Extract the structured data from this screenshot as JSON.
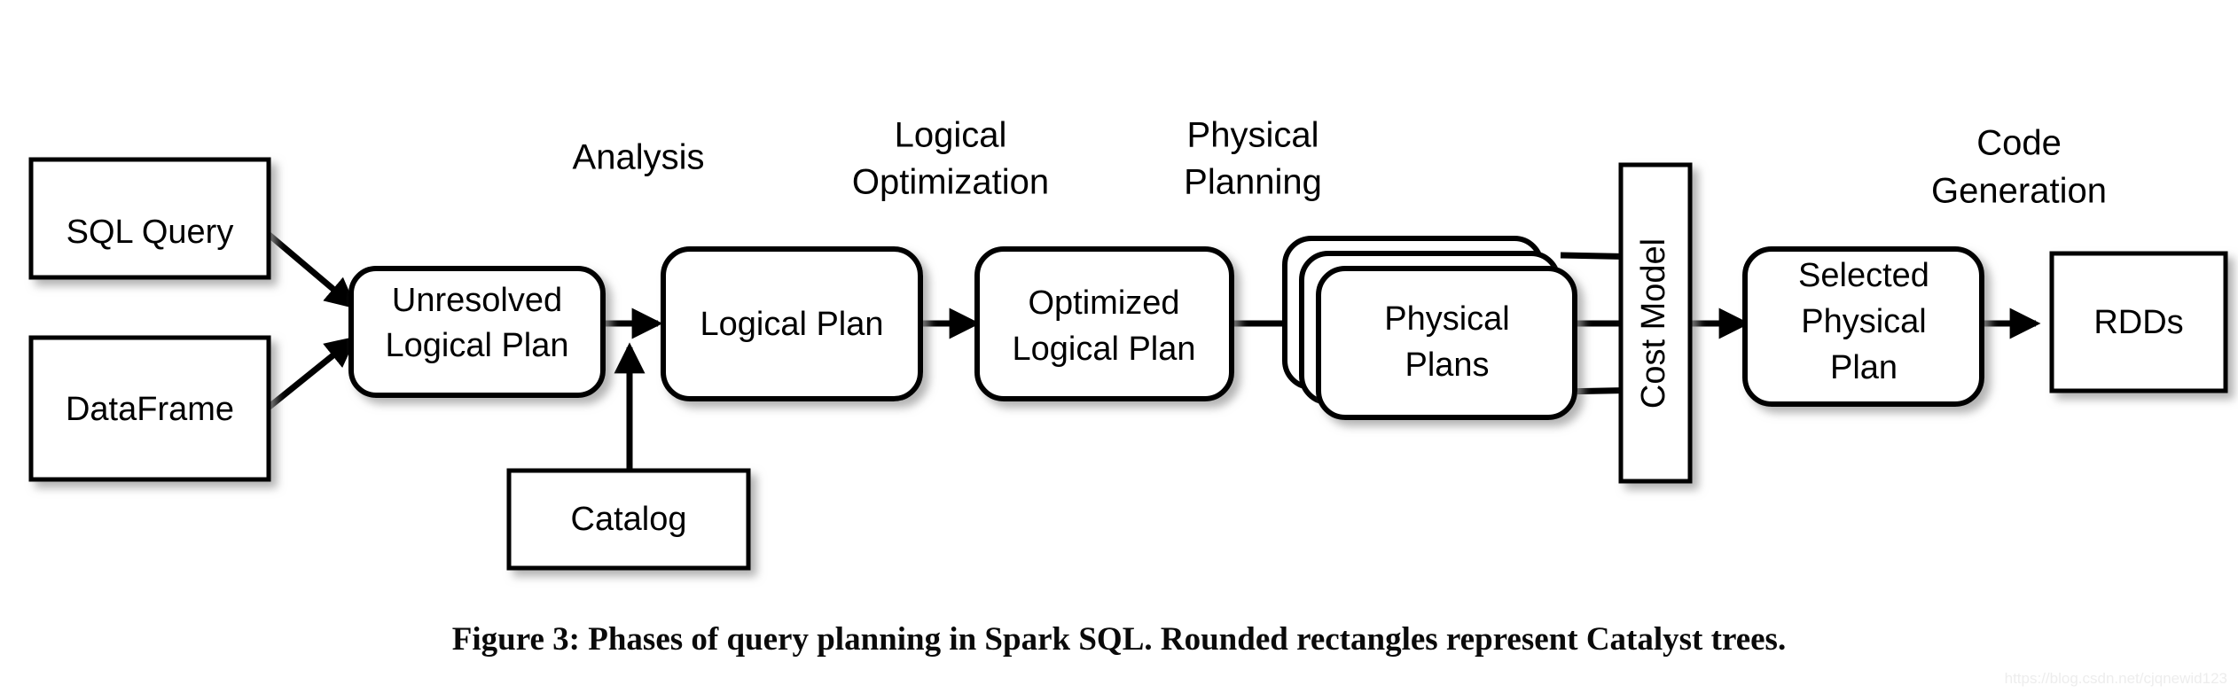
{
  "figure": {
    "caption": "Figure 3: Phases of query planning in Spark SQL. Rounded rectangles represent Catalyst trees.",
    "watermark": "https://blog.csdn.net/cjqnewid123"
  },
  "colors": {
    "stroke": "#000000",
    "fill": "#ffffff",
    "shadow": "#b4b4b4",
    "watermark": "#ededed"
  },
  "phases": [
    {
      "id": "analysis",
      "lines": [
        "Analysis"
      ]
    },
    {
      "id": "logical-optimization",
      "lines": [
        "Logical",
        "Optimization"
      ]
    },
    {
      "id": "physical-planning",
      "lines": [
        "Physical",
        "Planning"
      ]
    },
    {
      "id": "code-generation",
      "lines": [
        "Code",
        "Generation"
      ]
    }
  ],
  "nodes": [
    {
      "id": "sql-query",
      "shape": "rectangle",
      "lines": [
        "SQL Query"
      ]
    },
    {
      "id": "dataframe",
      "shape": "rectangle",
      "lines": [
        "DataFrame"
      ]
    },
    {
      "id": "unresolved-logical-plan",
      "shape": "rounded-rectangle",
      "lines": [
        "Unresolved",
        "Logical Plan"
      ]
    },
    {
      "id": "catalog",
      "shape": "rectangle",
      "lines": [
        "Catalog"
      ]
    },
    {
      "id": "logical-plan",
      "shape": "rounded-rectangle",
      "lines": [
        "Logical Plan"
      ]
    },
    {
      "id": "optimized-logical-plan",
      "shape": "rounded-rectangle",
      "lines": [
        "Optimized",
        "Logical Plan"
      ]
    },
    {
      "id": "physical-plans",
      "shape": "rounded-rectangle-stack",
      "lines": [
        "Physical",
        "Plans"
      ]
    },
    {
      "id": "cost-model",
      "shape": "rectangle-vertical",
      "lines": [
        "Cost Model"
      ]
    },
    {
      "id": "selected-physical-plan",
      "shape": "rounded-rectangle",
      "lines": [
        "Selected",
        "Physical",
        "Plan"
      ]
    },
    {
      "id": "rdds",
      "shape": "rectangle",
      "lines": [
        "RDDs"
      ]
    }
  ],
  "edges": [
    {
      "from": "sql-query",
      "to": "unresolved-logical-plan",
      "kind": "arrow"
    },
    {
      "from": "dataframe",
      "to": "unresolved-logical-plan",
      "kind": "arrow"
    },
    {
      "from": "unresolved-logical-plan",
      "to": "logical-plan",
      "kind": "arrow"
    },
    {
      "from": "catalog",
      "to": "analysis-arrow",
      "kind": "arrow"
    },
    {
      "from": "logical-plan",
      "to": "optimized-logical-plan",
      "kind": "arrow"
    },
    {
      "from": "optimized-logical-plan",
      "to": "physical-plans",
      "kind": "arrow"
    },
    {
      "from": "physical-plans",
      "to": "cost-model",
      "kind": "line"
    },
    {
      "from": "cost-model",
      "to": "selected-physical-plan",
      "kind": "arrow"
    },
    {
      "from": "selected-physical-plan",
      "to": "rdds",
      "kind": "arrow"
    }
  ]
}
